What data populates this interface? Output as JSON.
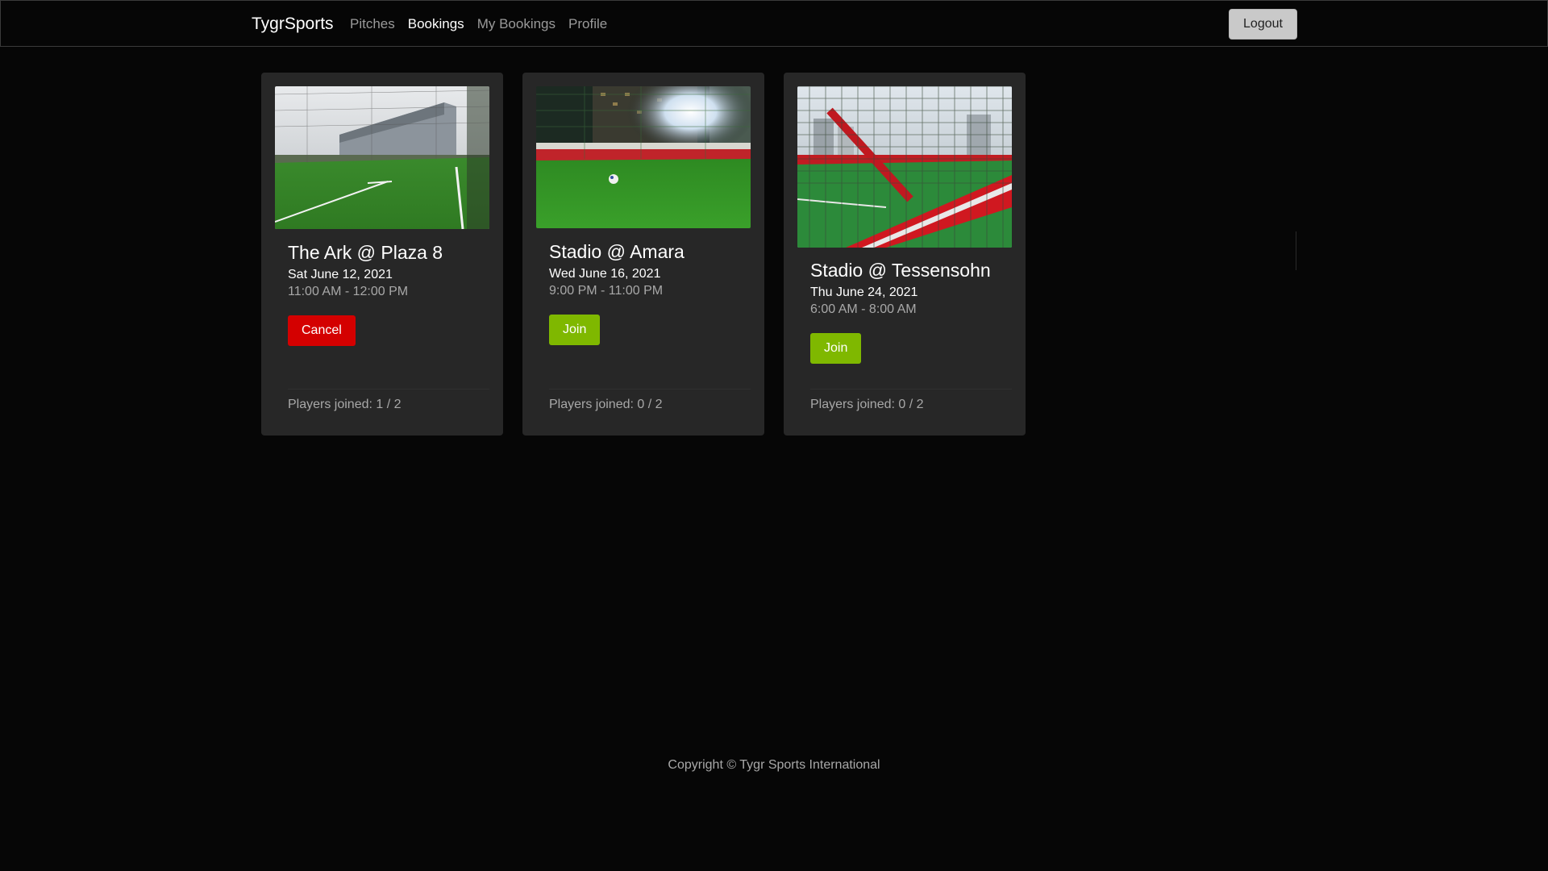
{
  "nav": {
    "brand": "TygrSports",
    "links": [
      {
        "label": "Pitches",
        "active": false
      },
      {
        "label": "Bookings",
        "active": true
      },
      {
        "label": "My Bookings",
        "active": false
      },
      {
        "label": "Profile",
        "active": false
      }
    ],
    "logout_label": "Logout"
  },
  "bookings": [
    {
      "title": "The Ark @ Plaza 8",
      "date": "Sat June 12, 2021",
      "time": "11:00 AM - 12:00 PM",
      "action_label": "Cancel",
      "action_color": "#d40000",
      "players": "Players joined: 1 / 2"
    },
    {
      "title": "Stadio @ Amara",
      "date": "Wed June 16, 2021",
      "time": "9:00 PM - 11:00 PM",
      "action_label": "Join",
      "action_color": "#7fb800",
      "players": "Players joined: 0 / 2"
    },
    {
      "title": "Stadio @ Tessensohn",
      "date": "Thu June 24, 2021",
      "time": "6:00 AM - 8:00 AM",
      "action_label": "Join",
      "action_color": "#7fb800",
      "players": "Players joined: 0 / 2"
    }
  ],
  "footer": {
    "copyright": "Copyright © Tygr Sports International"
  }
}
